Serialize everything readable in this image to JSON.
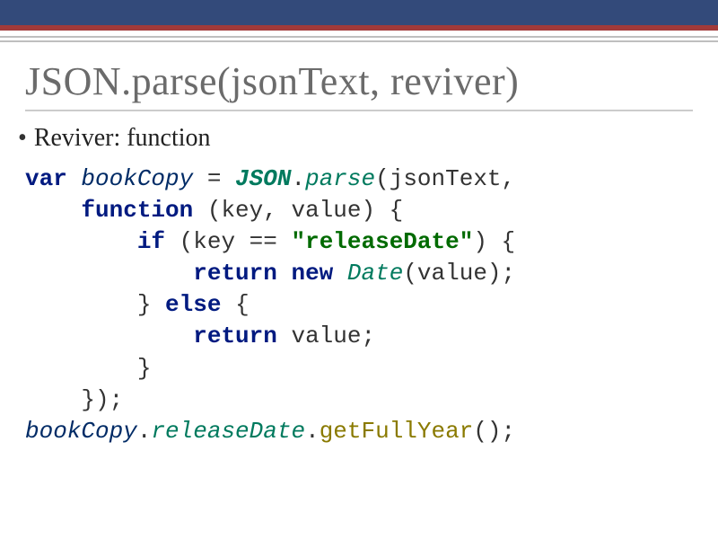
{
  "header": {
    "title": "JSON.parse(jsonText, reviver)"
  },
  "bullet": "Reviver: function",
  "code": {
    "l1": {
      "kw": "var",
      "sp1": " ",
      "ident": "bookCopy",
      "eq": " = ",
      "type": "JSON",
      "dot": ".",
      "method": "parse",
      "open": "(jsonText,"
    },
    "l2": {
      "kw": "function",
      "rest": " (key, value) {"
    },
    "l3": {
      "kw": "if",
      "pre": " (key == ",
      "str": "\"releaseDate\"",
      "post": ") {"
    },
    "l4": {
      "kw1": "return",
      "sp": " ",
      "kw2": "new",
      "sp2": " ",
      "type": "Date",
      "call": "(value);"
    },
    "l5": {
      "brace": "} ",
      "kw": "else",
      "rest": " {"
    },
    "l6": {
      "kw": "return",
      "rest": " value;"
    },
    "l7": {
      "brace": "}"
    },
    "l8": {
      "close": "});"
    },
    "l9": {
      "obj": "bookCopy",
      "dot1": ".",
      "prop": "releaseDate",
      "dot2": ".",
      "method": "getFullYear",
      "call": "();"
    }
  }
}
